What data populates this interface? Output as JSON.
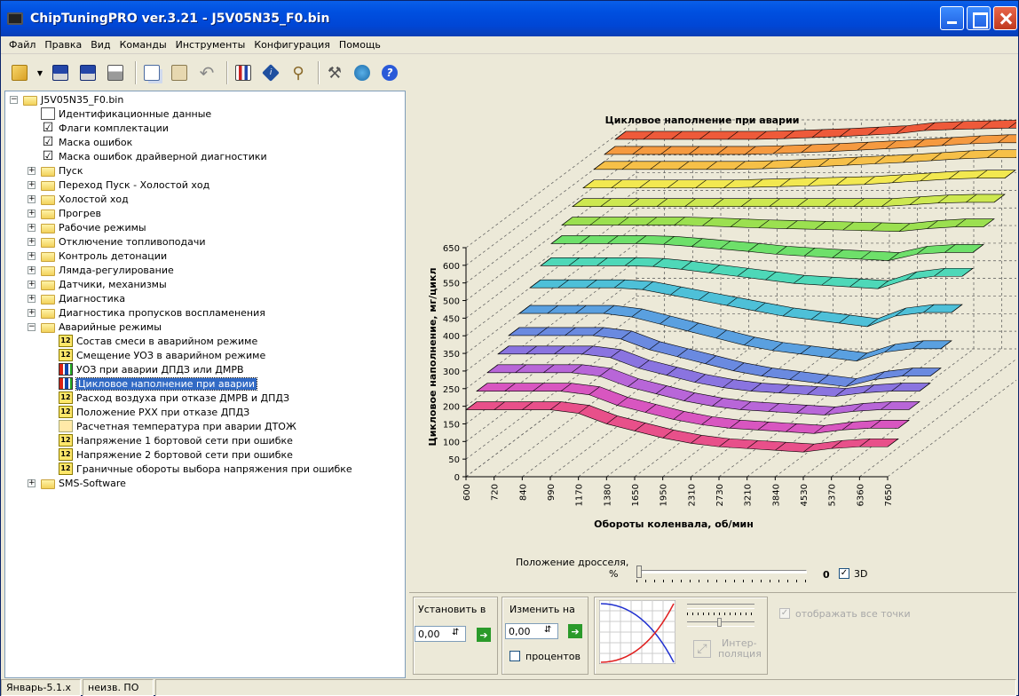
{
  "window": {
    "title": "ChipTuningPRO ver.3.21 - J5V05N35_F0.bin"
  },
  "menu": [
    "Файл",
    "Правка",
    "Вид",
    "Команды",
    "Инструменты",
    "Конфигурация",
    "Помощь"
  ],
  "toolbar": [
    "open-icon",
    "save-icon",
    "save-as-icon",
    "print-icon",
    "copy-icon",
    "paste-icon",
    "undo-icon",
    "chart-icon",
    "info-icon",
    "search-icon",
    "tools-icon",
    "network-icon",
    "help-icon"
  ],
  "tree": {
    "root": "J5V05N35_F0.bin",
    "items": [
      "Идентификационные данные",
      "Флаги комплектации",
      "Маска ошибок",
      "Маска ошибок драйверной диагностики",
      "Пуск",
      "Переход Пуск - Холостой ход",
      "Холостой ход",
      "Прогрев",
      "Рабочие режимы",
      "Отключение топливоподачи",
      "Контроль детонации",
      "Лямда-регулирование",
      "Датчики, механизмы",
      "Диагностика",
      "Диагностика пропусков воспламенения",
      "Аварийные режимы",
      "Состав смеси в аварийном режиме",
      "Смещение УОЗ в аварийном режиме",
      "УОЗ при аварии ДПДЗ или ДМРВ",
      "Цикловое наполнение при аварии",
      "Расход воздуха при отказе ДМРВ и ДПДЗ",
      "Положение РХХ при отказе ДПДЗ",
      "Расчетная температура при аварии ДТОЖ",
      "Напряжение 1 бортовой сети при ошибке",
      "Напряжение 2 бортовой сети при ошибке",
      "Граничные обороты выбора напряжения при ошибке",
      "SMS-Software"
    ]
  },
  "chart_data": {
    "type": "surface3d",
    "title": "Цикловое наполнение при аварии",
    "xlabel": "Обороты коленвала, об/мин",
    "ylabel": "Цикловое наполнение, мг/цикл",
    "x": [
      600,
      720,
      840,
      990,
      1170,
      1380,
      1650,
      1950,
      2310,
      2730,
      3210,
      3840,
      4530,
      5370,
      6360,
      7650
    ],
    "yticks": [
      0,
      50,
      100,
      150,
      200,
      250,
      300,
      350,
      400,
      450,
      500,
      550,
      600,
      650
    ],
    "ylim": [
      0,
      650
    ],
    "series": [
      {
        "color": "#e8508a",
        "values": [
          190,
          190,
          190,
          190,
          180,
          150,
          130,
          110,
          95,
          85,
          80,
          75,
          70,
          80,
          85,
          85
        ]
      },
      {
        "color": "#d856c0",
        "values": [
          220,
          220,
          220,
          220,
          210,
          180,
          160,
          140,
          125,
          115,
          110,
          105,
          100,
          110,
          115,
          115
        ]
      },
      {
        "color": "#b866d8",
        "values": [
          250,
          250,
          250,
          250,
          240,
          210,
          190,
          170,
          155,
          145,
          140,
          135,
          130,
          140,
          145,
          145
        ]
      },
      {
        "color": "#8a74e0",
        "values": [
          280,
          280,
          280,
          280,
          270,
          240,
          220,
          200,
          185,
          175,
          170,
          165,
          160,
          170,
          175,
          175
        ]
      },
      {
        "color": "#6a8ae0",
        "values": [
          310,
          310,
          310,
          310,
          300,
          270,
          250,
          230,
          210,
          195,
          185,
          175,
          165,
          185,
          195,
          195
        ]
      },
      {
        "color": "#5aa0e0",
        "values": [
          350,
          350,
          350,
          350,
          340,
          320,
          300,
          280,
          260,
          245,
          235,
          225,
          215,
          240,
          250,
          250
        ]
      },
      {
        "color": "#4ec0d8",
        "values": [
          400,
          400,
          400,
          400,
          395,
          380,
          365,
          350,
          335,
          320,
          310,
          300,
          290,
          320,
          330,
          330
        ]
      },
      {
        "color": "#4ed8b8",
        "values": [
          440,
          440,
          440,
          440,
          438,
          430,
          420,
          410,
          400,
          390,
          385,
          380,
          375,
          400,
          410,
          410
        ]
      },
      {
        "color": "#6ee06a",
        "values": [
          480,
          480,
          480,
          480,
          478,
          472,
          465,
          458,
          450,
          445,
          440,
          436,
          432,
          450,
          455,
          455
        ]
      },
      {
        "color": "#9be050",
        "values": [
          510,
          510,
          510,
          510,
          510,
          508,
          505,
          502,
          500,
          498,
          496,
          494,
          492,
          500,
          505,
          505
        ]
      },
      {
        "color": "#cde850",
        "values": [
          540,
          540,
          540,
          540,
          540,
          540,
          540,
          540,
          540,
          540,
          540,
          540,
          545,
          550,
          552,
          552
        ]
      },
      {
        "color": "#f2e850",
        "values": [
          570,
          570,
          570,
          570,
          570,
          570,
          572,
          574,
          576,
          578,
          580,
          585,
          590,
          595,
          598,
          598
        ]
      },
      {
        "color": "#f6c048",
        "values": [
          600,
          600,
          600,
          600,
          600,
          600,
          602,
          605,
          608,
          612,
          616,
          620,
          625,
          630,
          633,
          633
        ]
      },
      {
        "color": "#f59a40",
        "values": [
          620,
          620,
          620,
          620,
          620,
          620,
          622,
          625,
          628,
          632,
          636,
          640,
          645,
          650,
          653,
          653
        ]
      },
      {
        "color": "#ee5a3a",
        "values": [
          640,
          640,
          640,
          640,
          640,
          640,
          642,
          645,
          648,
          652,
          656,
          665,
          668,
          670,
          672,
          672
        ]
      }
    ]
  },
  "throttle": {
    "label_line1": "Положение дросселя,",
    "label_line2": "%",
    "value": "0",
    "checkbox_label": "3D",
    "checked": true,
    "level": 0
  },
  "controls": {
    "set_label": "Установить в",
    "set_value": "0,00",
    "change_label": "Изменить на",
    "change_value": "0,00",
    "percent_label": "процентов",
    "interp_label_1": "Интер-",
    "interp_label_2": "поляция",
    "show_all_label": "отображать все точки"
  },
  "status": [
    "Январь-5.1.x",
    "неизв. ПО",
    ""
  ]
}
